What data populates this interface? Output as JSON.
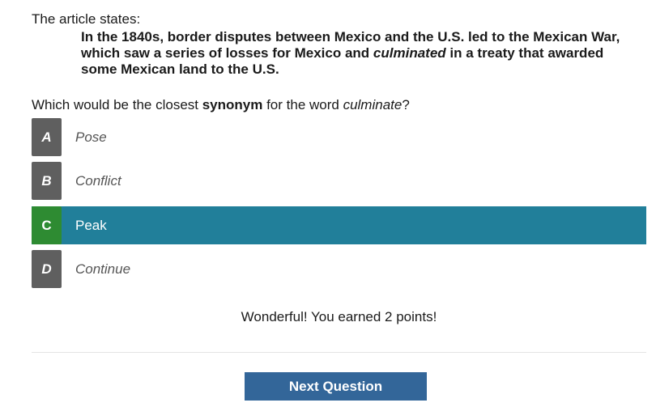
{
  "intro_label": "The article states:",
  "quote": {
    "line1": "In the 1840s, border disputes between Mexico and the U.S. led to the Mexican War,",
    "line2_before": "which saw a series of losses for Mexico and ",
    "line2_italic": "culminated",
    "line2_after": " in a treaty that awarded",
    "line3": "some Mexican land to the U.S."
  },
  "question": {
    "before": "Which would be the closest ",
    "bold": "synonym",
    "middle": " for the word ",
    "italic": "culminate",
    "after": "?"
  },
  "options": [
    {
      "letter": "A",
      "text": "Pose",
      "selected": false
    },
    {
      "letter": "B",
      "text": "Conflict",
      "selected": false
    },
    {
      "letter": "C",
      "text": "Peak",
      "selected": true
    },
    {
      "letter": "D",
      "text": "Continue",
      "selected": false
    }
  ],
  "feedback": "Wonderful! You earned 2 points!",
  "next_button_label": "Next Question",
  "colors": {
    "selected_row": "#217f9a",
    "correct_letter": "#2e8b32",
    "letter_default": "#5f5f5f",
    "button": "#336699"
  }
}
